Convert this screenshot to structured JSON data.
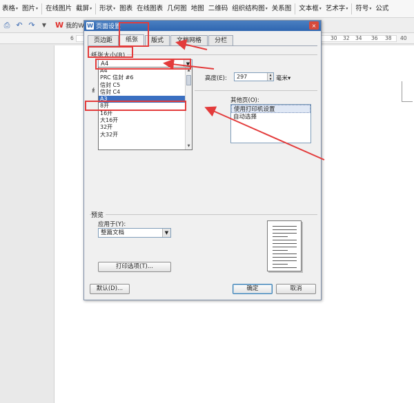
{
  "ribbon": {
    "items": [
      {
        "label": "表格",
        "caret": true
      },
      {
        "label": "图片",
        "caret": true
      },
      {
        "label": "在线图片",
        "caret": false
      },
      {
        "label": "截屏",
        "caret": true
      },
      {
        "label": "形状",
        "caret": true
      },
      {
        "label": "图表",
        "caret": false
      },
      {
        "label": "在线图表",
        "caret": false
      },
      {
        "label": "几何图",
        "caret": false
      },
      {
        "label": "地图",
        "caret": false
      },
      {
        "label": "二维码",
        "caret": false
      },
      {
        "label": "组织结构图",
        "caret": true
      },
      {
        "label": "关系图",
        "caret": false
      },
      {
        "label": "文本框",
        "caret": true
      },
      {
        "label": "艺术字",
        "caret": true
      },
      {
        "label": "符号",
        "caret": true
      },
      {
        "label": "公式",
        "caret": false
      }
    ],
    "caret_glyph": "▾"
  },
  "qbar": {
    "tab_label": "我的WPS",
    "logo": "W"
  },
  "ruler": {
    "left": "6",
    "right": [
      "30",
      "32",
      "34",
      "36",
      "38",
      "40"
    ]
  },
  "dialog": {
    "title": "页面设置",
    "title_icon": "W",
    "close_glyph": "×",
    "tabs": [
      "页边距",
      "纸张",
      "版式",
      "文档网格",
      "分栏"
    ],
    "paper_size_label": "纸张大小(R)",
    "paper_size_value": "A4",
    "dropdown_glyph": "▼",
    "paper_list": [
      "A4",
      "PRC 信封 #6",
      "信封 C5",
      "信封 C4",
      "A3",
      "8开",
      "16开",
      "大16开",
      "32开",
      "大32开"
    ],
    "paper_list_selected": 4,
    "clipped_label": "纟",
    "height_label": "高度(E):",
    "height_value": "297",
    "unit_value": "毫米",
    "unit_caret": "▾",
    "other_pages_label": "其他页(O):",
    "other_pages_items": [
      "使用打印机设置",
      "自动选择"
    ],
    "preview_label": "预览",
    "apply_to_label": "应用于(Y):",
    "apply_to_value": "整篇文档",
    "print_options_button": "打印选项(T)...",
    "default_button": "默认(D)...",
    "ok_button": "确定",
    "cancel_button": "取消"
  },
  "colors": {
    "annotation_red": "#e33b3b",
    "titlebar_blue": "#2f66b0",
    "selection_blue": "#3a6fc1"
  }
}
